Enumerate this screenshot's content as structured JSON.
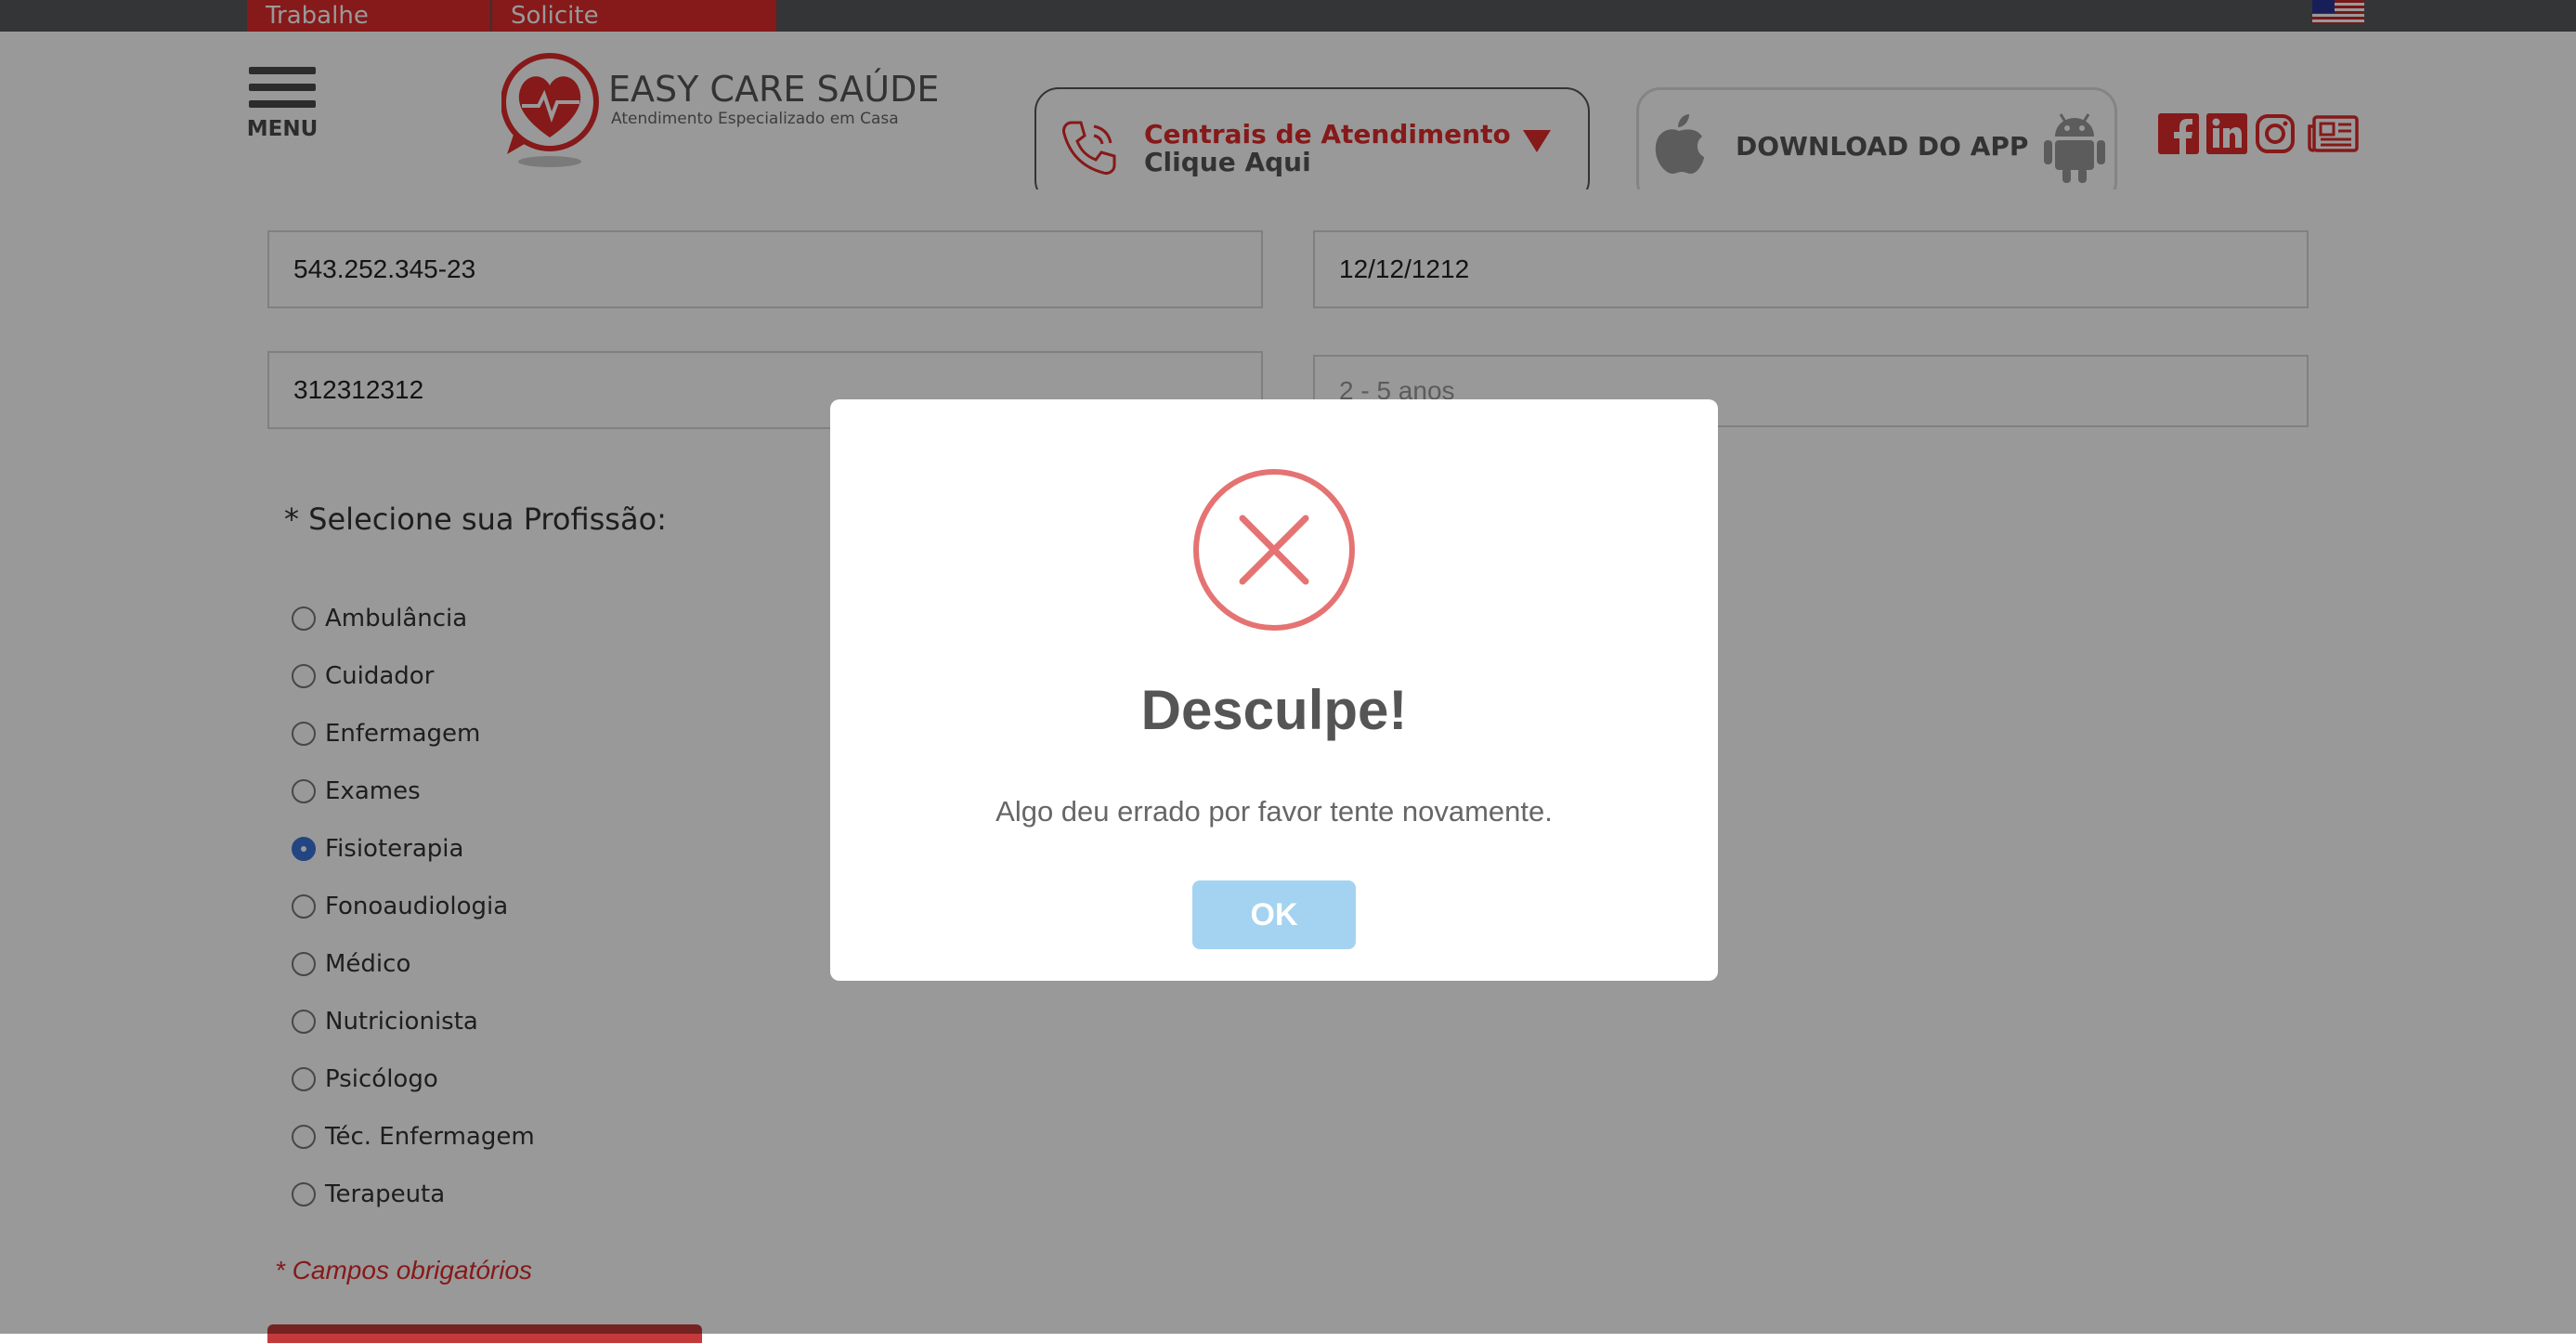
{
  "topbar": {
    "links": [
      "Trabalhe Conosco",
      "Solicite Atendimento"
    ],
    "language_flag": "us-flag-icon"
  },
  "header": {
    "menu_label": "MENU",
    "logo_name": "EASY CARE SAÚDE",
    "logo_tagline": "Atendimento Especializado em Casa",
    "contact_title": "Centrais de Atendimento",
    "contact_sub": "Clique Aqui",
    "app_label": "DOWNLOAD DO APP",
    "social_icons": [
      "facebook-icon",
      "linkedin-icon",
      "instagram-icon",
      "news-icon"
    ]
  },
  "form": {
    "cpf": "543.252.345-23",
    "birth_date": "12/12/1212",
    "phone": "312312312",
    "experience_placeholder": "2 - 5 anos",
    "profession_title": "* Selecione sua Profissão:",
    "professions": [
      "Ambulância",
      "Cuidador",
      "Enfermagem",
      "Exames",
      "Fisioterapia",
      "Fonoaudiologia",
      "Médico",
      "Nutricionista",
      "Psicólogo",
      "Téc. Enfermagem",
      "Terapeuta"
    ],
    "selected_profession": "Fisioterapia",
    "required_note": "* Campos obrigatórios"
  },
  "modal": {
    "title": "Desculpe!",
    "message": "Algo deu errado por favor tente novamente.",
    "ok_label": "OK",
    "icon": "error-x-icon"
  },
  "colors": {
    "brand_red": "#e02b2b",
    "topbar": "#58595b",
    "error_icon": "#e57373",
    "ok_button": "#a3d3f0",
    "radio_selected": "#3b73d9"
  }
}
